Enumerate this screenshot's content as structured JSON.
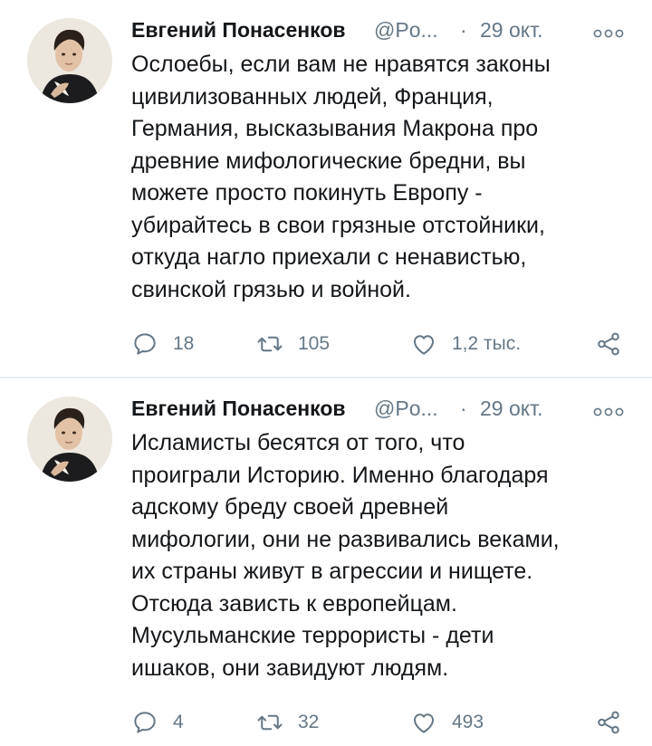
{
  "tweets": [
    {
      "author_name": "Евгений Понасенков",
      "author_handle": "@Po...",
      "separator": "·",
      "date": "29 окт.",
      "text": "Ослоебы, если вам не нравятся законы\nцивилизованных людей, Франция,\nГермания, высказывания Макрона про\nдревние мифологические бредни, вы\nможете просто покинуть Европу -\nубирайтесь в свои грязные отстойники,\nоткуда нагло приехали с ненавистью,\nсвинской грязью и войной.",
      "replies": "18",
      "retweets": "105",
      "likes": "1,2 тыс."
    },
    {
      "author_name": "Евгений Понасенков",
      "author_handle": "@Po...",
      "separator": "·",
      "date": "29 окт.",
      "text": "Исламисты бесятся от того, что\nпроиграли Историю. Именно благодаря\nадскому бреду своей древней\nмифологии, они не развивались веками,\nих страны живут в агрессии и нищете.\nОтсюда зависть к европейцам.\nМусульманские террористы - дети\nишаков, они завидуют людям.",
      "replies": "4",
      "retweets": "32",
      "likes": "493"
    }
  ],
  "icons": {
    "reply": "reply-icon",
    "retweet": "retweet-icon",
    "like": "like-icon",
    "share": "share-icon",
    "more": "more-options-icon"
  },
  "colors": {
    "text": "#14171a",
    "secondary": "#657786",
    "divider": "#e6ecf0"
  }
}
